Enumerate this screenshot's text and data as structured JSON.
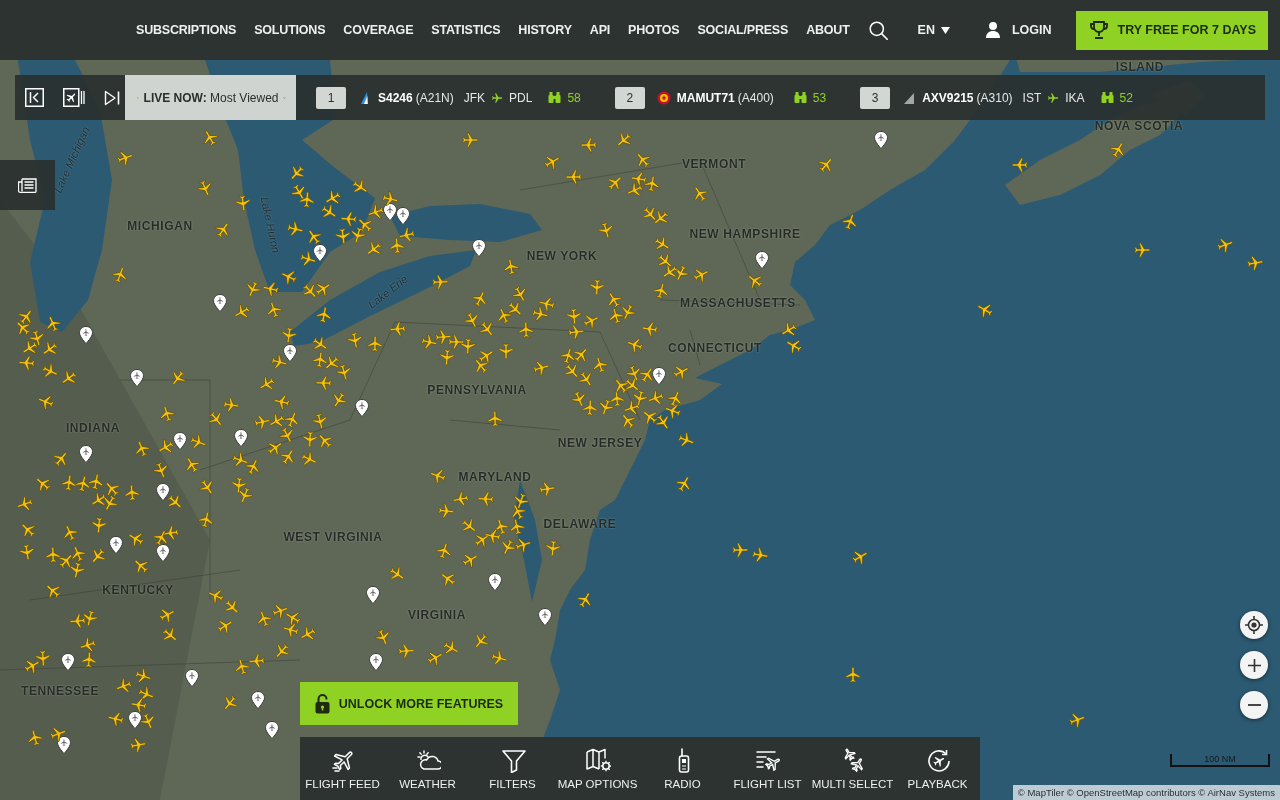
{
  "header": {
    "links": [
      "SUBSCRIPTIONS",
      "SOLUTIONS",
      "COVERAGE",
      "STATISTICS",
      "HISTORY",
      "API",
      "PHOTOS",
      "SOCIAL/PRESS",
      "ABOUT"
    ],
    "language": "EN",
    "login": "LOGIN",
    "trial_button": "TRY FREE FOR 7 DAYS"
  },
  "most_viewed": {
    "feed": "**LIVE NOW:** Most Viewed",
    "flights": [
      {
        "rank": "1",
        "callsign": "S4246",
        "aircraft": "(A21N)",
        "origin": "JFK",
        "destination": "PDL",
        "viewers": "58"
      },
      {
        "rank": "2",
        "callsign": "MAMUT71",
        "aircraft": "(A400)",
        "viewers": "53"
      },
      {
        "rank": "3",
        "callsign": "AXV9215",
        "aircraft": "(A310)",
        "origin": "IST",
        "destination": "IKA",
        "viewers": "52"
      }
    ]
  },
  "map": {
    "region_labels": [
      "ISLAND",
      "NOVA SCOTIA",
      "VERMONT",
      "MICHIGAN",
      "NEW HAMPSHIRE",
      "NEW YORK",
      "MASSACHUSETTS",
      "CONNECTICUT",
      "PENNSYLVANIA",
      "NEW JERSEY",
      "INDIANA",
      "MARYLAND",
      "DELAWARE",
      "WEST VIRGINIA",
      "KENTUCKY",
      "VIRGINIA",
      "TENNESSEE"
    ],
    "water_labels": [
      "Lake Michigan",
      "Lake Huron",
      "Lake Erie"
    ],
    "scale": "100 NM",
    "attribution": "© MapTiler © OpenStreetMap contributors © AirNav Systems"
  },
  "unlock_button": "UNLOCK MORE FEATURES",
  "toolbar": [
    "FLIGHT FEED",
    "WEATHER",
    "FILTERS",
    "MAP OPTIONS",
    "RADIO",
    "FLIGHT LIST",
    "MULTI SELECT",
    "PLAYBACK"
  ]
}
